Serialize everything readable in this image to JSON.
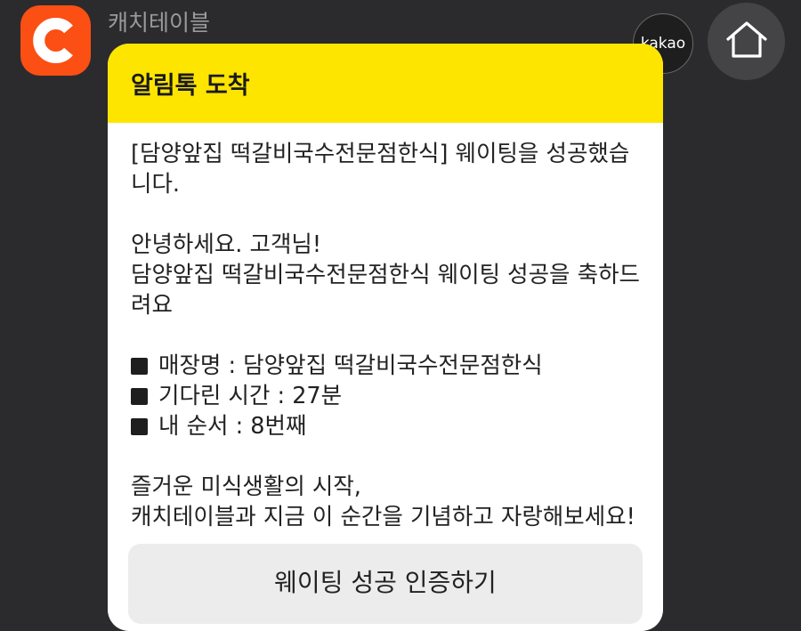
{
  "colors": {
    "background": "#2b2b2d",
    "app_icon": "#fb4f14",
    "header": "#fee500",
    "bubble": "#ffffff",
    "button": "#ececec"
  },
  "sender": {
    "name": "캐치테이블",
    "icon": "catchtable-logo-icon"
  },
  "badge": {
    "label": "kakao"
  },
  "home": {
    "icon": "home-icon"
  },
  "message": {
    "header_title": "알림톡 도착",
    "headline": "[담양앞집 떡갈비국수전문점한식] 웨이팅을 성공했습니다.",
    "greeting_line1": "안녕하세요. 고객님!",
    "greeting_line2": "담양앞집 떡갈비국수전문점한식 웨이팅 성공을 축하드려요",
    "details": [
      {
        "label": "매장명 : 담양앞집 떡갈비국수전문점한식"
      },
      {
        "label": "기다린 시간 : 27분"
      },
      {
        "label": "내 순서 : 8번째"
      }
    ],
    "closing_line1": "즐거운 미식생활의 시작,",
    "closing_line2": "캐치테이블과 지금 이 순간을 기념하고 자랑해보세요!",
    "button_label": "웨이팅 성공 인증하기"
  }
}
